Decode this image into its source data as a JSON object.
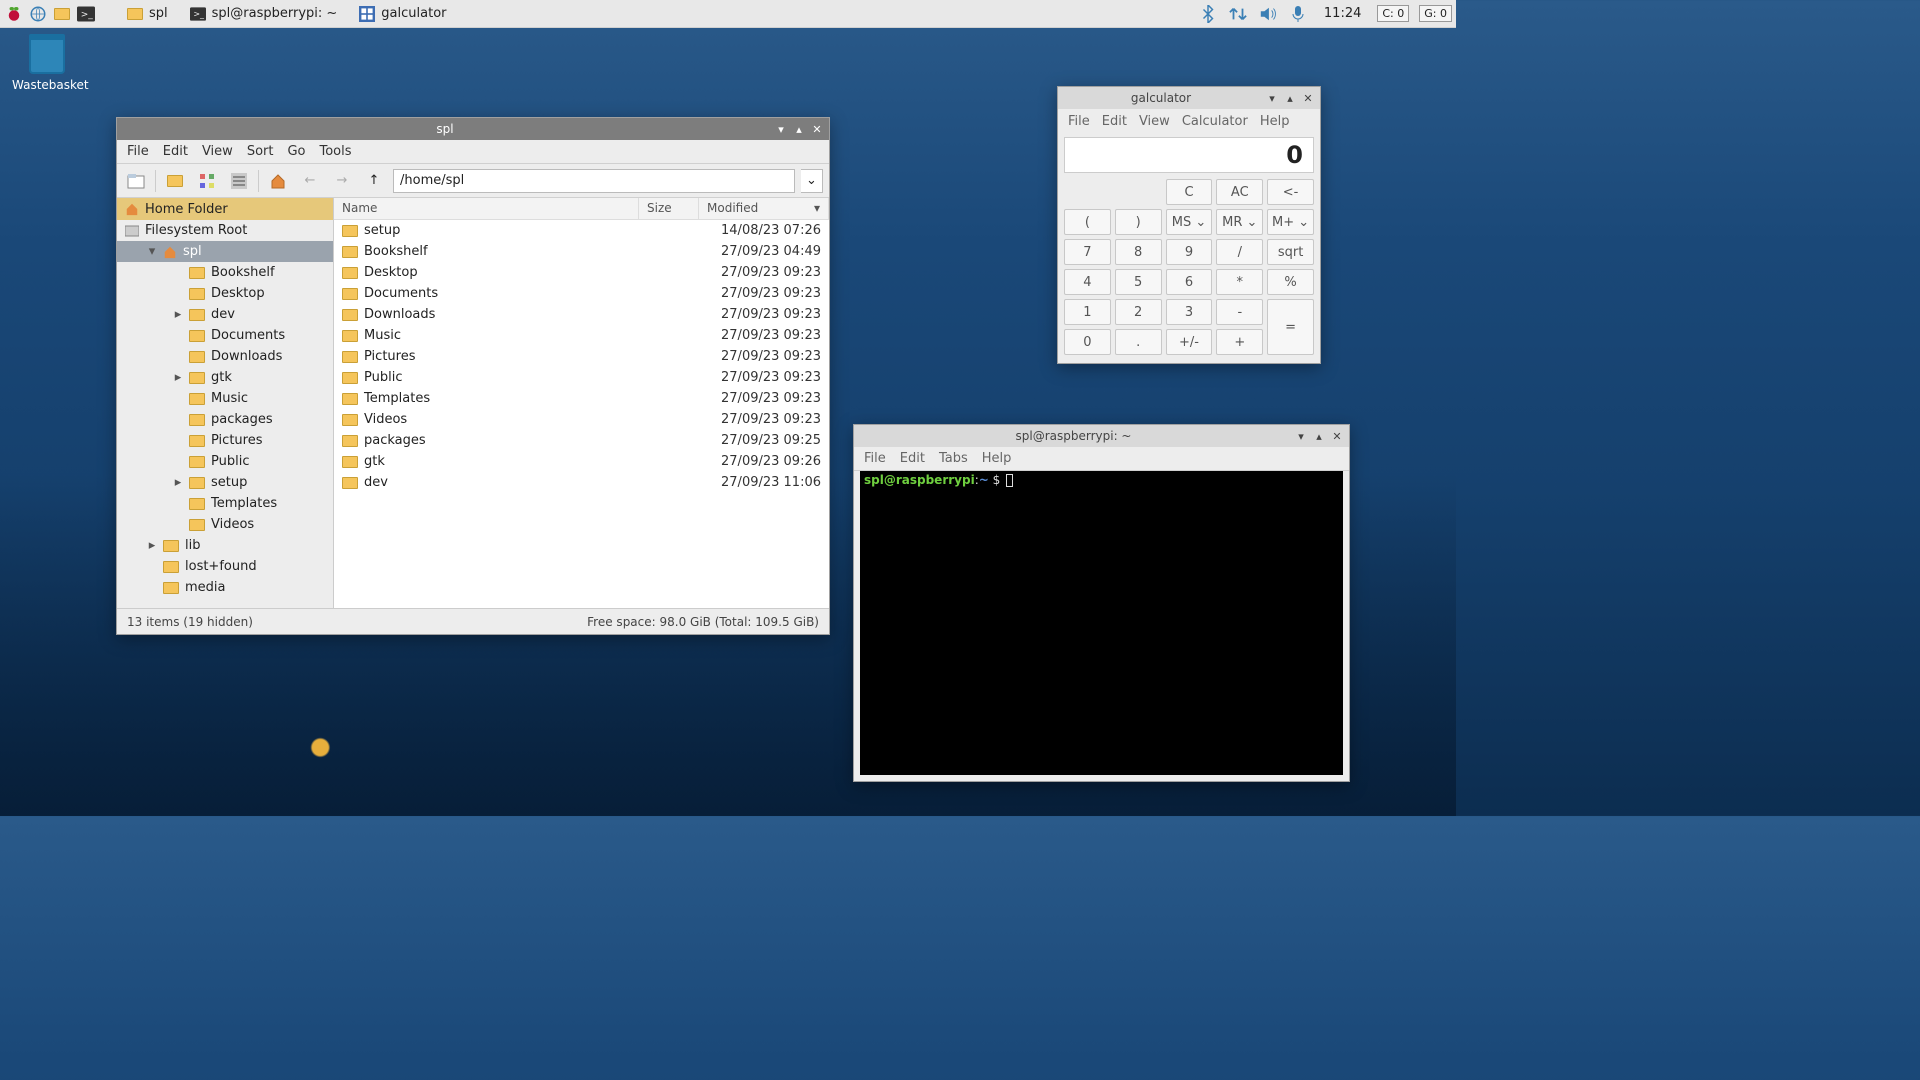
{
  "panel": {
    "tasks": [
      {
        "icon": "folder",
        "label": "spl"
      },
      {
        "icon": "terminal",
        "label": "spl@raspberrypi: ~"
      },
      {
        "icon": "calc",
        "label": "galculator"
      }
    ],
    "clock": "11:24",
    "badges": [
      "C:  0",
      "G:  0"
    ]
  },
  "desktop": {
    "wastebasket": "Wastebasket"
  },
  "fm": {
    "title": "spl",
    "menus": [
      "File",
      "Edit",
      "View",
      "Sort",
      "Go",
      "Tools"
    ],
    "path": "/home/spl",
    "sidebar": {
      "home": "Home Folder",
      "root": "Filesystem Root",
      "current": "spl",
      "children": [
        {
          "n": "Bookshelf"
        },
        {
          "n": "Desktop"
        },
        {
          "n": "dev",
          "exp": true
        },
        {
          "n": "Documents"
        },
        {
          "n": "Downloads"
        },
        {
          "n": "gtk",
          "exp": true
        },
        {
          "n": "Music"
        },
        {
          "n": "packages"
        },
        {
          "n": "Pictures"
        },
        {
          "n": "Public"
        },
        {
          "n": "setup",
          "exp": true
        },
        {
          "n": "Templates"
        },
        {
          "n": "Videos"
        }
      ],
      "siblings": [
        {
          "n": "lib",
          "exp": true
        },
        {
          "n": "lost+found"
        },
        {
          "n": "media"
        }
      ]
    },
    "columns": {
      "name": "Name",
      "size": "Size",
      "mod": "Modified"
    },
    "files": [
      {
        "n": "setup",
        "m": "14/08/23 07:26"
      },
      {
        "n": "Bookshelf",
        "m": "27/09/23 04:49"
      },
      {
        "n": "Desktop",
        "m": "27/09/23 09:23"
      },
      {
        "n": "Documents",
        "m": "27/09/23 09:23"
      },
      {
        "n": "Downloads",
        "m": "27/09/23 09:23"
      },
      {
        "n": "Music",
        "m": "27/09/23 09:23"
      },
      {
        "n": "Pictures",
        "m": "27/09/23 09:23"
      },
      {
        "n": "Public",
        "m": "27/09/23 09:23"
      },
      {
        "n": "Templates",
        "m": "27/09/23 09:23"
      },
      {
        "n": "Videos",
        "m": "27/09/23 09:23"
      },
      {
        "n": "packages",
        "m": "27/09/23 09:25"
      },
      {
        "n": "gtk",
        "m": "27/09/23 09:26"
      },
      {
        "n": "dev",
        "m": "27/09/23 11:06"
      }
    ],
    "status_left": "13 items (19 hidden)",
    "status_right": "Free space: 98.0 GiB (Total: 109.5 GiB)"
  },
  "calc": {
    "title": "galculator",
    "menus": [
      "File",
      "Edit",
      "View",
      "Calculator",
      "Help"
    ],
    "display": "0",
    "row0": [
      "",
      "",
      "C",
      "AC",
      "<-"
    ],
    "row1": [
      "(",
      ")",
      "MS ⌄",
      "MR ⌄",
      "M+ ⌄"
    ],
    "row2": [
      "7",
      "8",
      "9",
      "/",
      "sqrt"
    ],
    "row3": [
      "4",
      "5",
      "6",
      "*",
      "%"
    ],
    "row4": [
      "1",
      "2",
      "3",
      "-",
      "="
    ],
    "row5": [
      "0",
      ".",
      "+/-",
      "+"
    ]
  },
  "term": {
    "title": "spl@raspberrypi: ~",
    "menus": [
      "File",
      "Edit",
      "Tabs",
      "Help"
    ],
    "prompt_user": "spl@raspberrypi",
    "prompt_sep": ":",
    "prompt_path": "~",
    "prompt_end": " $ "
  }
}
